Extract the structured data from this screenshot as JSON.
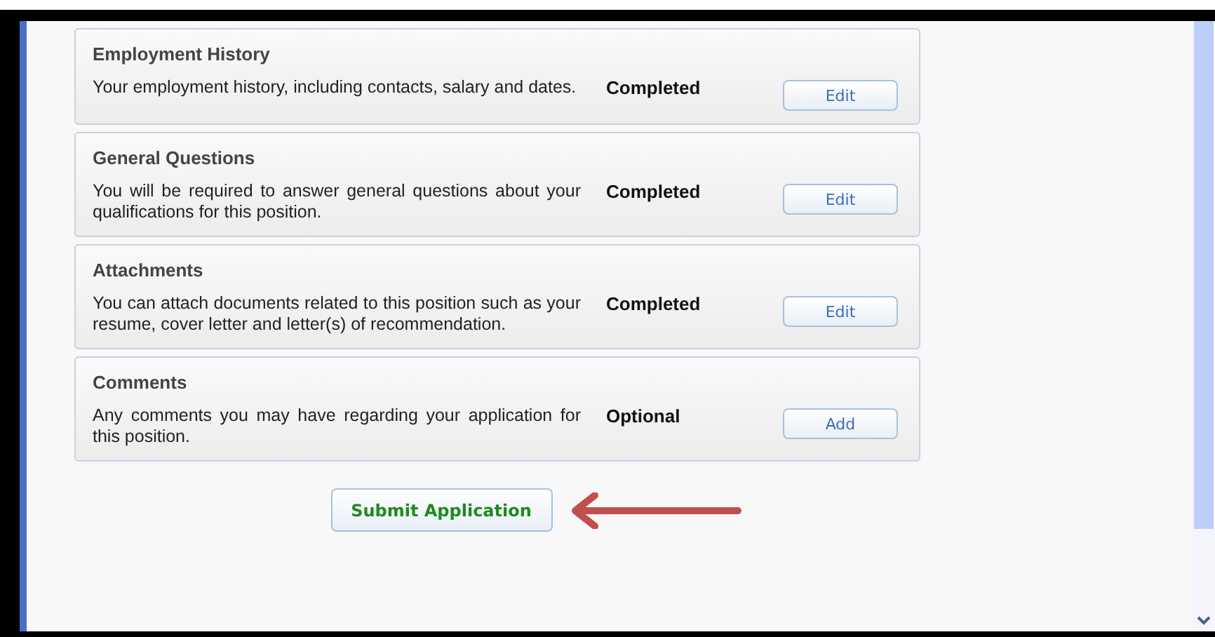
{
  "sections": [
    {
      "title": "Employment History",
      "description": "Your employment history, including contacts, salary and dates.",
      "status": "Completed",
      "button": "Edit"
    },
    {
      "title": "General Questions",
      "description": "You will be required to answer general questions about your qualifications for this position.",
      "status": "Completed",
      "button": "Edit"
    },
    {
      "title": "Attachments",
      "description": "You can attach documents related to this position such as your resume, cover letter and letter(s) of recommendation.",
      "status": "Completed",
      "button": "Edit"
    },
    {
      "title": "Comments",
      "description": "Any comments you may have regarding your application for this position.",
      "status": "Optional",
      "button": "Add"
    }
  ],
  "submit_button": "Submit Application"
}
